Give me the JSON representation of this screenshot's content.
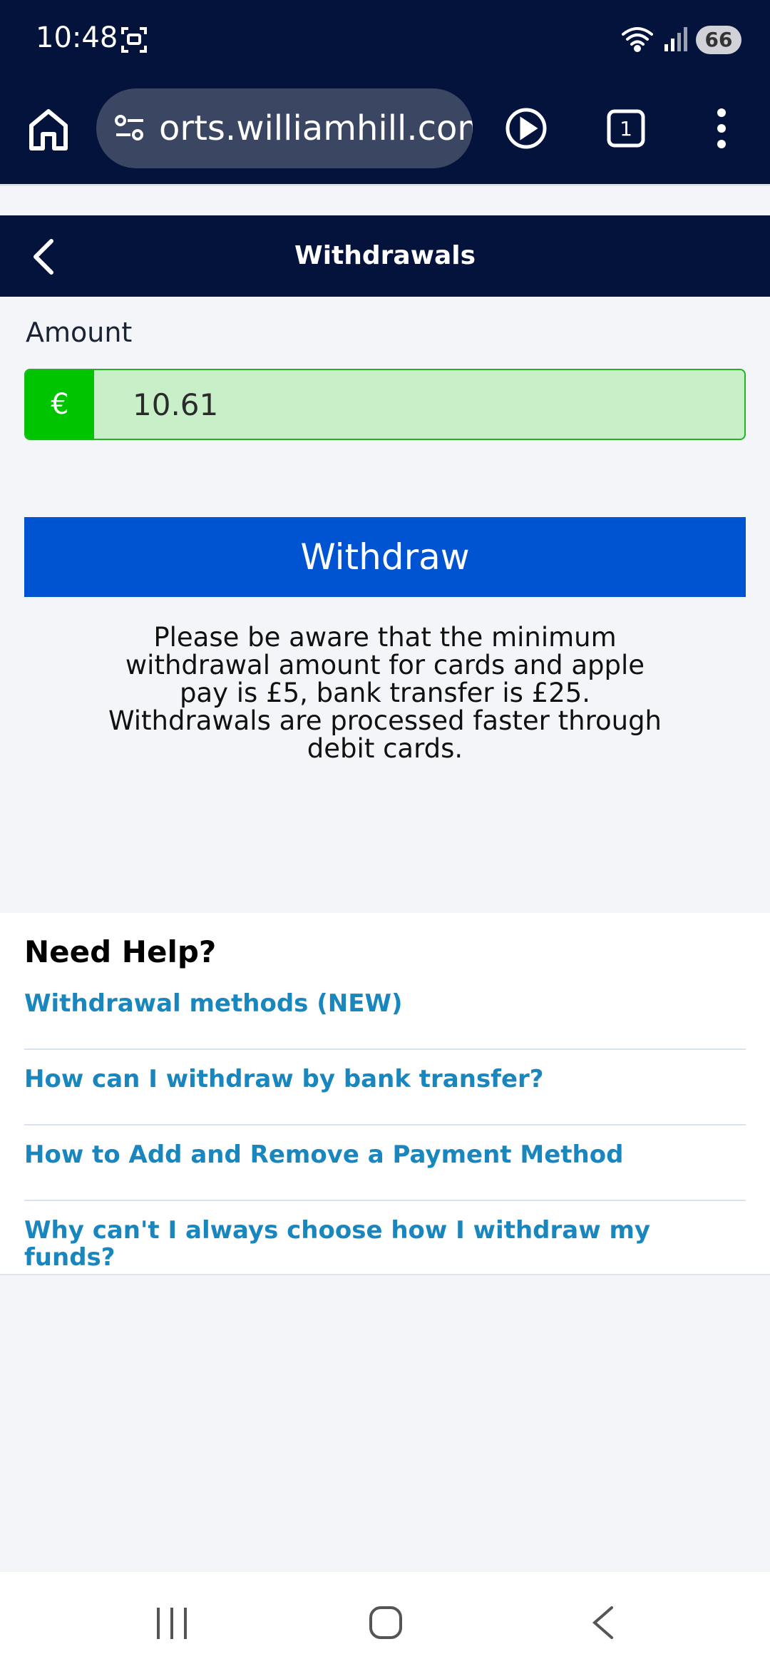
{
  "status_bar": {
    "time": "10:48",
    "battery": "66",
    "icons": [
      "screenshot-icon",
      "wifi-icon",
      "signal-icon",
      "battery-icon"
    ]
  },
  "browser": {
    "url": "orts.williamhill.com",
    "tab_count": "1",
    "icons": [
      "home-icon",
      "site-settings-icon",
      "play-icon",
      "tabs-icon",
      "more-vert-icon"
    ]
  },
  "header": {
    "title": "Withdrawals",
    "back_icon": "chevron-left-icon"
  },
  "form": {
    "amount_label": "Amount",
    "currency_symbol": "€",
    "amount_value": "10.61",
    "withdraw_label": "Withdraw",
    "notice": "Please be aware that the minimum withdrawal amount for cards and apple pay is £5, bank transfer is £25. Withdrawals are processed faster through debit cards."
  },
  "help": {
    "title": "Need Help?",
    "links": [
      {
        "label": "Withdrawal methods (NEW)"
      },
      {
        "label": "How can I withdraw by bank transfer?"
      },
      {
        "label": "How to Add and Remove a Payment Method"
      },
      {
        "label": "Why can't I always choose how I withdraw my funds?"
      }
    ]
  },
  "colors": {
    "header_bg": "#03133b",
    "button_blue": "#0154d1",
    "currency_green": "#00c400",
    "input_bg": "#c8efc8",
    "link_blue": "#1a86be"
  }
}
